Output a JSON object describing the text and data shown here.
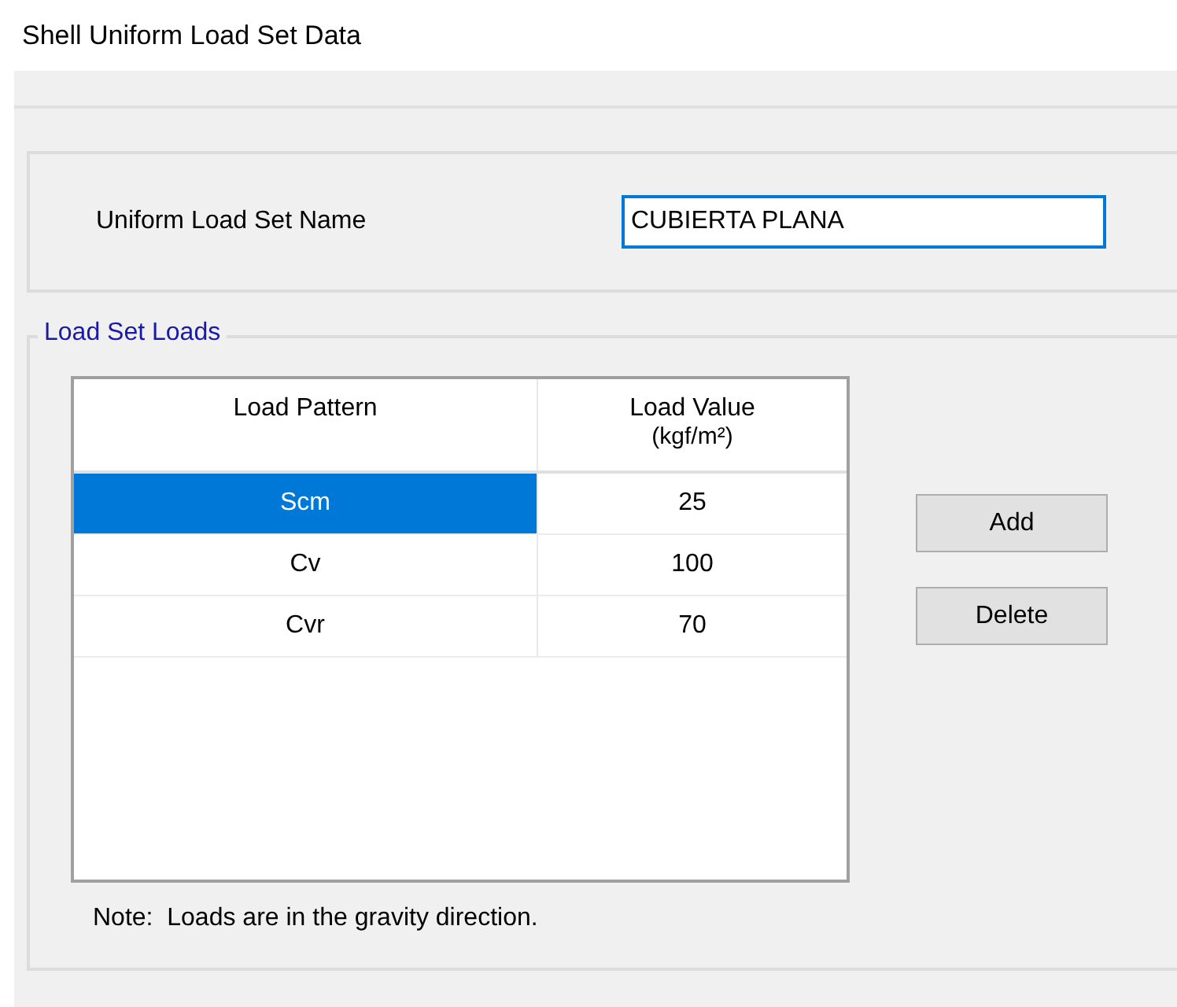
{
  "window": {
    "title": "Shell Uniform Load Set Data"
  },
  "name_field": {
    "label": "Uniform Load Set Name",
    "value": "CUBIERTA PLANA"
  },
  "loads_group": {
    "title": "Load Set Loads",
    "table": {
      "columns": [
        {
          "label": "Load Pattern"
        },
        {
          "label": "Load Value",
          "unit": "(kgf/m²)"
        }
      ],
      "rows": [
        {
          "pattern": "Scm",
          "value": "25",
          "selected": true
        },
        {
          "pattern": "Cv",
          "value": "100",
          "selected": false
        },
        {
          "pattern": "Cvr",
          "value": "70",
          "selected": false
        }
      ]
    },
    "buttons": [
      "Add",
      "Delete"
    ],
    "note": "Note:  Loads are in the gravity direction."
  }
}
